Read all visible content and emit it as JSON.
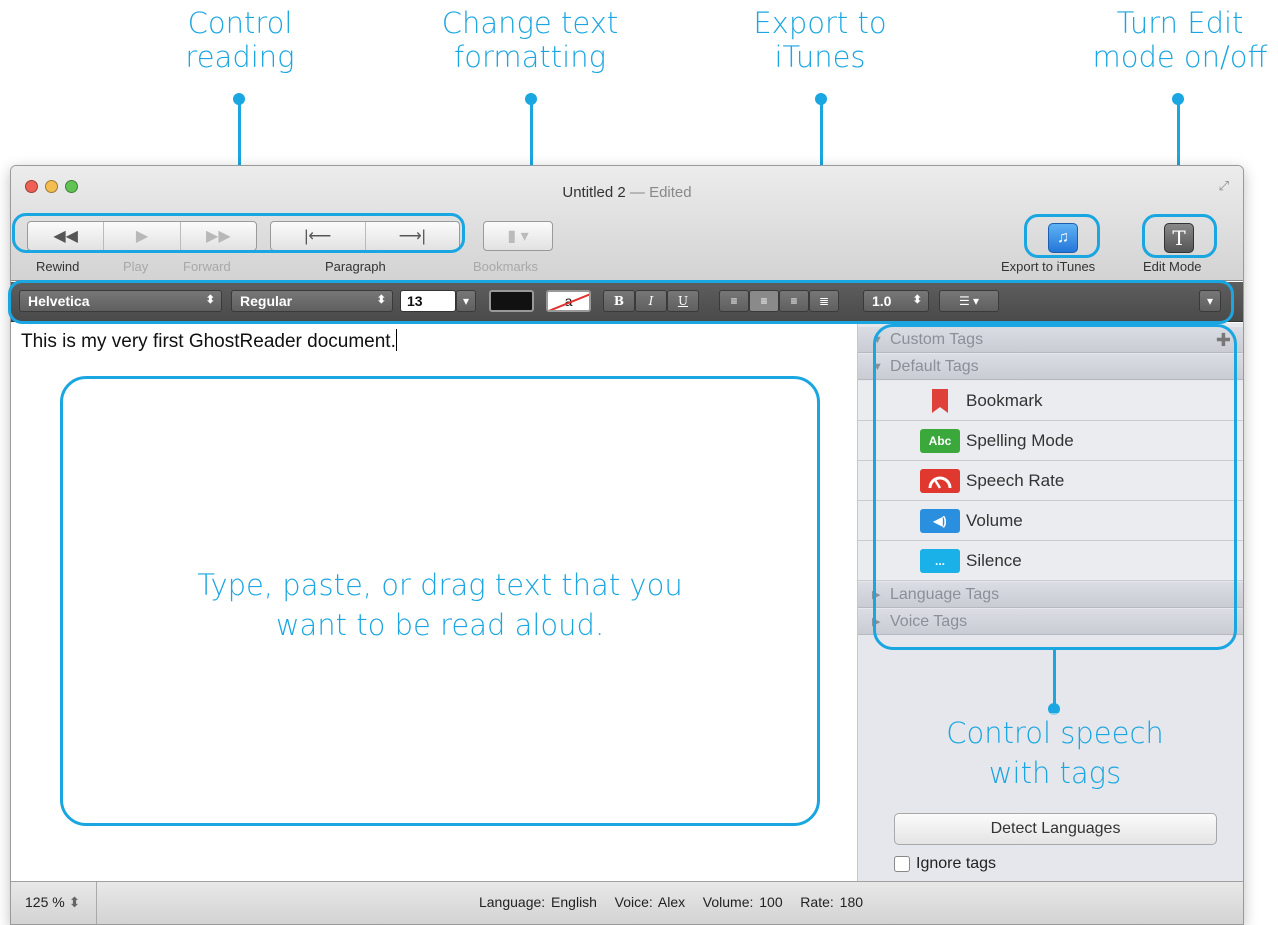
{
  "callouts": {
    "control_reading": [
      "Control",
      "reading"
    ],
    "change_formatting": [
      "Change text",
      "formatting"
    ],
    "export_itunes": [
      "Export to",
      "iTunes"
    ],
    "edit_mode": [
      "Turn Edit",
      "mode on/off"
    ],
    "control_speech": [
      "Control speech",
      "with tags"
    ],
    "editor_hint": [
      "Type, paste, or drag text that you",
      "want to be read aloud."
    ]
  },
  "window": {
    "title": "Untitled 2",
    "title_suffix": "— Edited"
  },
  "toolbar": {
    "rewind_label": "Rewind",
    "play_label": "Play",
    "forward_label": "Forward",
    "paragraph_label": "Paragraph",
    "bookmarks_label": "Bookmarks",
    "export_label": "Export to iTunes",
    "edit_mode_label": "Edit Mode",
    "edit_mode_glyph": "T"
  },
  "format_bar": {
    "font": "Helvetica",
    "style": "Regular",
    "size": "13",
    "no_bg_glyph": "a",
    "bold": "B",
    "italic": "I",
    "underline": "U",
    "line_spacing": "1.0"
  },
  "editor": {
    "text": "This is my very first GhostReader document."
  },
  "sidebar": {
    "custom_tags": "Custom Tags",
    "default_tags": "Default Tags",
    "tags": [
      {
        "label": "Bookmark",
        "icon": "bookmark-icon",
        "color": "#e0403a"
      },
      {
        "label": "Spelling Mode",
        "icon": "abc-icon",
        "glyph": "Abc",
        "color": "#3aa83a"
      },
      {
        "label": "Speech Rate",
        "icon": "speedometer-icon",
        "color": "#e0382e"
      },
      {
        "label": "Volume",
        "icon": "speaker-icon",
        "color": "#2b8fe0"
      },
      {
        "label": "Silence",
        "icon": "ellipsis-icon",
        "glyph": "...",
        "color": "#1ab0e8"
      }
    ],
    "language_tags": "Language Tags",
    "voice_tags": "Voice Tags",
    "detect_button": "Detect Languages",
    "ignore_tags": "Ignore tags"
  },
  "status_bar": {
    "zoom": "125 %",
    "info": "Language: English   Voice: Alex   Volume: 100   Rate: 180"
  },
  "colors": {
    "accent": "#1aa6e0",
    "close": "#ee5f55",
    "minimize": "#f4bd4f",
    "zoom": "#61c354"
  }
}
